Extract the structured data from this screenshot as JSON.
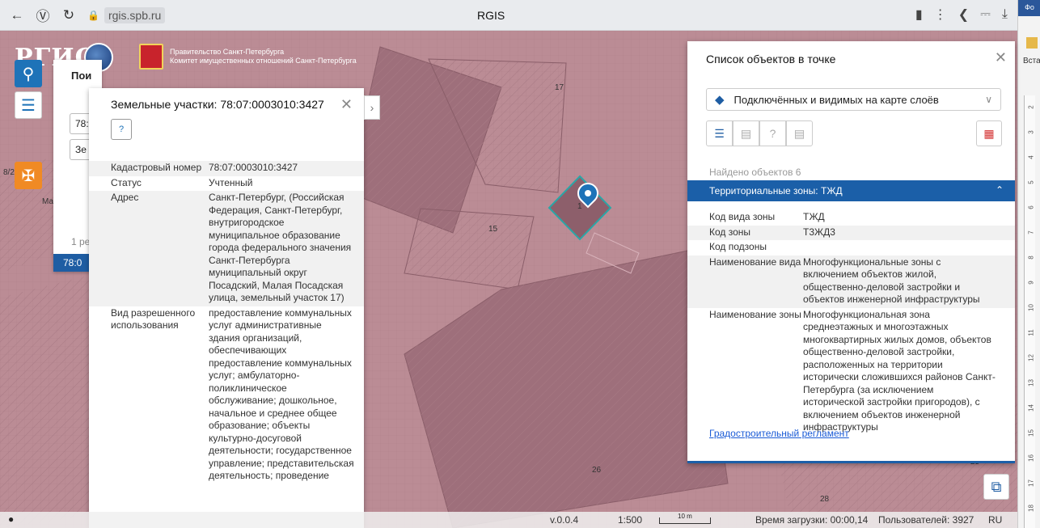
{
  "browser": {
    "url": "rgis.spb.ru",
    "tab_title": "RGIS",
    "side_tab": "Фо",
    "side_insert": "Вста"
  },
  "ruler_marks": [
    "2",
    "3",
    "4",
    "5",
    "6",
    "7",
    "8",
    "9",
    "10",
    "11",
    "12",
    "13",
    "14",
    "15",
    "16",
    "17",
    "18"
  ],
  "header": {
    "logo": "РГИС",
    "gov_line1": "Правительство Санкт-Петербурга",
    "gov_line2": "Комитет имущественных отношений Санкт-Петербурга"
  },
  "map_labels": {
    "l17": "17",
    "l15": "15",
    "l1": "1",
    "l26": "26",
    "l28": "28",
    "l25": "25",
    "l82": "8/2",
    "lma": "Ма"
  },
  "search_panel": {
    "title": "Пои",
    "input1": "78:",
    "input2": "Зе",
    "pages": "1 ре",
    "selected": "78:0"
  },
  "parcel_panel": {
    "title": "Земельные участки: 78:07:0003010:3427",
    "rows": [
      {
        "k": "Кадастровый номер",
        "v": "78:07:0003010:3427"
      },
      {
        "k": "Статус",
        "v": "Учтенный"
      },
      {
        "k": "Адрес",
        "v": "Санкт-Петербург, (Российская Федерация, Санкт-Петербург, внутригородское муниципальное образование города федерального значения Санкт-Петербурга муниципальный округ Посадский, Малая Посадская улица, земельный участок 17)"
      },
      {
        "k": "Вид разрешенного использования",
        "v": "предоставление коммунальных услуг административные здания организаций, обеспечивающих предоставление коммунальных услуг; амбулаторно-поликлиническое обслуживание; дошкольное, начальное и среднее общее образование; объекты культурно-досуговой деятельности; государственное управление; представительская деятельность; проведение"
      }
    ]
  },
  "objects_panel": {
    "title": "Список объектов в точке",
    "layer_select": "Подключённых и видимых на карте слоёв",
    "found": "Найдено объектов 6",
    "zone_header": "Территориальные зоны: ТЖД",
    "rows": [
      {
        "k": "Код вида зоны",
        "v": "ТЖД"
      },
      {
        "k": "Код зоны",
        "v": "Т3ЖД3"
      },
      {
        "k": "Код подзоны",
        "v": ""
      },
      {
        "k": "Наименование вида",
        "v": "Многофункциональные зоны с включением объектов жилой, общественно-деловой застройки и объектов инженерной инфраструктуры"
      },
      {
        "k": "Наименование зоны",
        "v": "Многофункциональная зона среднеэтажных и многоэтажных многоквартирных жилых домов, объектов общественно-деловой застройки, расположенных на территории исторически сложившихся районов Санкт-Петербурга (за исключением исторической застройки пригородов), с включением объектов инженерной инфраструктуры"
      }
    ],
    "link": "Градостроительный регламент"
  },
  "status_bar": {
    "version": "v.0.0.4",
    "scale": "1:500",
    "scale_unit": "10 m",
    "load_time": "Время загрузки: 00:00,14",
    "users": "Пользователей: 3927",
    "lang": "RU"
  },
  "colors": {
    "map_fill": "#bb8c95",
    "accent": "#1b5fa8",
    "selected_parcel": "#2aa6a6"
  }
}
